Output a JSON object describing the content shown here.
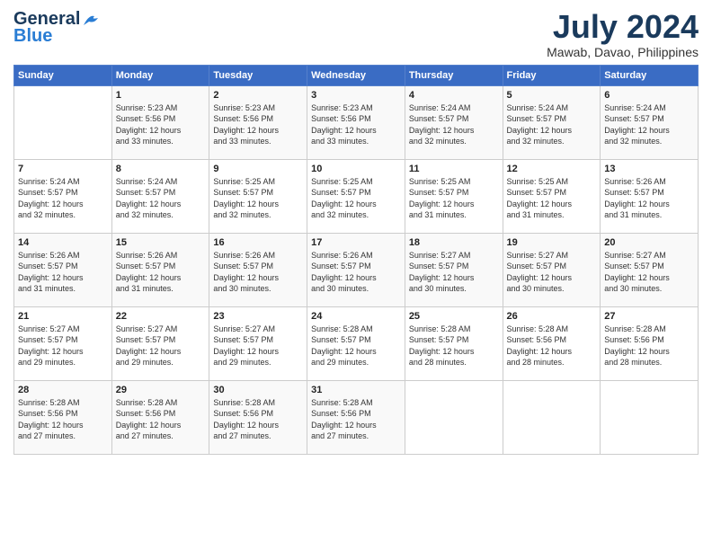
{
  "header": {
    "logo_line1": "General",
    "logo_line2": "Blue",
    "month_title": "July 2024",
    "location": "Mawab, Davao, Philippines"
  },
  "days_of_week": [
    "Sunday",
    "Monday",
    "Tuesday",
    "Wednesday",
    "Thursday",
    "Friday",
    "Saturday"
  ],
  "weeks": [
    [
      {
        "date": "",
        "info": ""
      },
      {
        "date": "1",
        "info": "Sunrise: 5:23 AM\nSunset: 5:56 PM\nDaylight: 12 hours\nand 33 minutes."
      },
      {
        "date": "2",
        "info": "Sunrise: 5:23 AM\nSunset: 5:56 PM\nDaylight: 12 hours\nand 33 minutes."
      },
      {
        "date": "3",
        "info": "Sunrise: 5:23 AM\nSunset: 5:56 PM\nDaylight: 12 hours\nand 33 minutes."
      },
      {
        "date": "4",
        "info": "Sunrise: 5:24 AM\nSunset: 5:57 PM\nDaylight: 12 hours\nand 32 minutes."
      },
      {
        "date": "5",
        "info": "Sunrise: 5:24 AM\nSunset: 5:57 PM\nDaylight: 12 hours\nand 32 minutes."
      },
      {
        "date": "6",
        "info": "Sunrise: 5:24 AM\nSunset: 5:57 PM\nDaylight: 12 hours\nand 32 minutes."
      }
    ],
    [
      {
        "date": "7",
        "info": "Sunrise: 5:24 AM\nSunset: 5:57 PM\nDaylight: 12 hours\nand 32 minutes."
      },
      {
        "date": "8",
        "info": "Sunrise: 5:24 AM\nSunset: 5:57 PM\nDaylight: 12 hours\nand 32 minutes."
      },
      {
        "date": "9",
        "info": "Sunrise: 5:25 AM\nSunset: 5:57 PM\nDaylight: 12 hours\nand 32 minutes."
      },
      {
        "date": "10",
        "info": "Sunrise: 5:25 AM\nSunset: 5:57 PM\nDaylight: 12 hours\nand 32 minutes."
      },
      {
        "date": "11",
        "info": "Sunrise: 5:25 AM\nSunset: 5:57 PM\nDaylight: 12 hours\nand 31 minutes."
      },
      {
        "date": "12",
        "info": "Sunrise: 5:25 AM\nSunset: 5:57 PM\nDaylight: 12 hours\nand 31 minutes."
      },
      {
        "date": "13",
        "info": "Sunrise: 5:26 AM\nSunset: 5:57 PM\nDaylight: 12 hours\nand 31 minutes."
      }
    ],
    [
      {
        "date": "14",
        "info": "Sunrise: 5:26 AM\nSunset: 5:57 PM\nDaylight: 12 hours\nand 31 minutes."
      },
      {
        "date": "15",
        "info": "Sunrise: 5:26 AM\nSunset: 5:57 PM\nDaylight: 12 hours\nand 31 minutes."
      },
      {
        "date": "16",
        "info": "Sunrise: 5:26 AM\nSunset: 5:57 PM\nDaylight: 12 hours\nand 30 minutes."
      },
      {
        "date": "17",
        "info": "Sunrise: 5:26 AM\nSunset: 5:57 PM\nDaylight: 12 hours\nand 30 minutes."
      },
      {
        "date": "18",
        "info": "Sunrise: 5:27 AM\nSunset: 5:57 PM\nDaylight: 12 hours\nand 30 minutes."
      },
      {
        "date": "19",
        "info": "Sunrise: 5:27 AM\nSunset: 5:57 PM\nDaylight: 12 hours\nand 30 minutes."
      },
      {
        "date": "20",
        "info": "Sunrise: 5:27 AM\nSunset: 5:57 PM\nDaylight: 12 hours\nand 30 minutes."
      }
    ],
    [
      {
        "date": "21",
        "info": "Sunrise: 5:27 AM\nSunset: 5:57 PM\nDaylight: 12 hours\nand 29 minutes."
      },
      {
        "date": "22",
        "info": "Sunrise: 5:27 AM\nSunset: 5:57 PM\nDaylight: 12 hours\nand 29 minutes."
      },
      {
        "date": "23",
        "info": "Sunrise: 5:27 AM\nSunset: 5:57 PM\nDaylight: 12 hours\nand 29 minutes."
      },
      {
        "date": "24",
        "info": "Sunrise: 5:28 AM\nSunset: 5:57 PM\nDaylight: 12 hours\nand 29 minutes."
      },
      {
        "date": "25",
        "info": "Sunrise: 5:28 AM\nSunset: 5:57 PM\nDaylight: 12 hours\nand 28 minutes."
      },
      {
        "date": "26",
        "info": "Sunrise: 5:28 AM\nSunset: 5:56 PM\nDaylight: 12 hours\nand 28 minutes."
      },
      {
        "date": "27",
        "info": "Sunrise: 5:28 AM\nSunset: 5:56 PM\nDaylight: 12 hours\nand 28 minutes."
      }
    ],
    [
      {
        "date": "28",
        "info": "Sunrise: 5:28 AM\nSunset: 5:56 PM\nDaylight: 12 hours\nand 27 minutes."
      },
      {
        "date": "29",
        "info": "Sunrise: 5:28 AM\nSunset: 5:56 PM\nDaylight: 12 hours\nand 27 minutes."
      },
      {
        "date": "30",
        "info": "Sunrise: 5:28 AM\nSunset: 5:56 PM\nDaylight: 12 hours\nand 27 minutes."
      },
      {
        "date": "31",
        "info": "Sunrise: 5:28 AM\nSunset: 5:56 PM\nDaylight: 12 hours\nand 27 minutes."
      },
      {
        "date": "",
        "info": ""
      },
      {
        "date": "",
        "info": ""
      },
      {
        "date": "",
        "info": ""
      }
    ]
  ]
}
